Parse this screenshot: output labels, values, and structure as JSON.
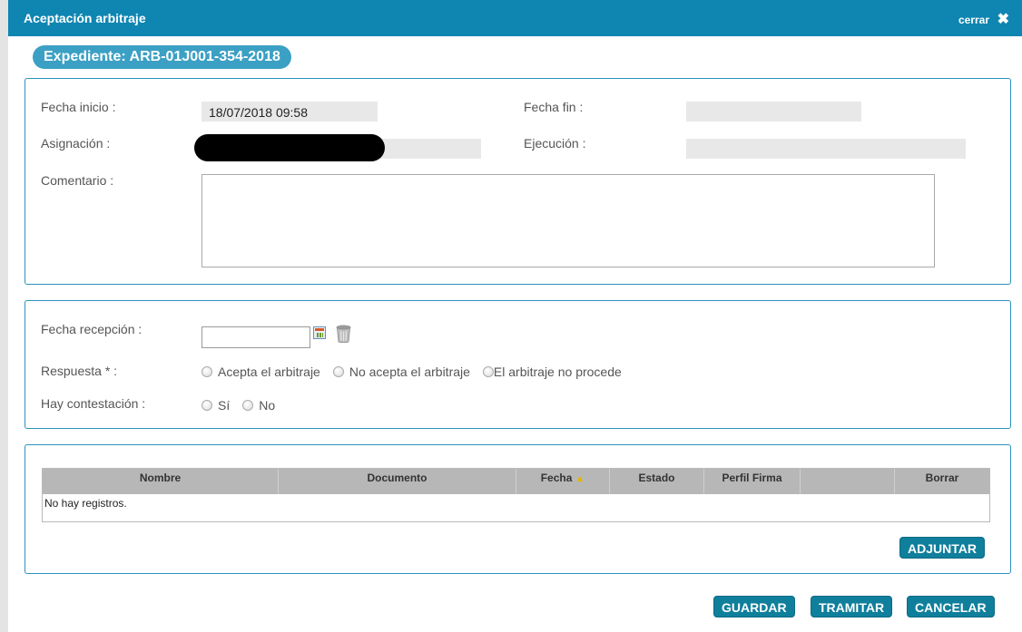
{
  "dialog": {
    "title": "Aceptación arbitraje",
    "close_label": "cerrar",
    "close_icon": "✖",
    "expediente": "Expediente: ARB-01J001-354-2018"
  },
  "info_panel": {
    "fecha_inicio_label": "Fecha inicio :",
    "fecha_inicio_value": "18/07/2018 09:58",
    "fecha_fin_label": "Fecha fin :",
    "fecha_fin_value": "",
    "asignacion_label": "Asignación :",
    "asignacion_value": "",
    "ejecucion_label": "Ejecución :",
    "ejecucion_value": "",
    "comentario_label": "Comentario :",
    "comentario_value": ""
  },
  "reception_panel": {
    "fecha_recepcion_label": "Fecha recepción :",
    "fecha_recepcion_value": "",
    "respuesta_label": "Respuesta * :",
    "respuesta_options": [
      "Acepta el arbitraje",
      "No acepta el arbitraje",
      "El arbitraje no procede"
    ],
    "contestacion_label": "Hay contestación :",
    "contestacion_options": [
      "Sí",
      "No"
    ]
  },
  "documents": {
    "columns": [
      "Nombre",
      "Documento",
      "Fecha",
      "Estado",
      "Perfil Firma",
      "",
      "Borrar"
    ],
    "sort_indicator": "▲",
    "empty_message": "No hay registros.",
    "attach_button": "ADJUNTAR"
  },
  "footer": {
    "save_button": "GUARDAR",
    "process_button": "TRAMITAR",
    "cancel_button": "CANCELAR"
  },
  "colors": {
    "titlebar": "#0f86b1",
    "panel_border": "#2b93bc",
    "button": "#0f7f9c"
  }
}
